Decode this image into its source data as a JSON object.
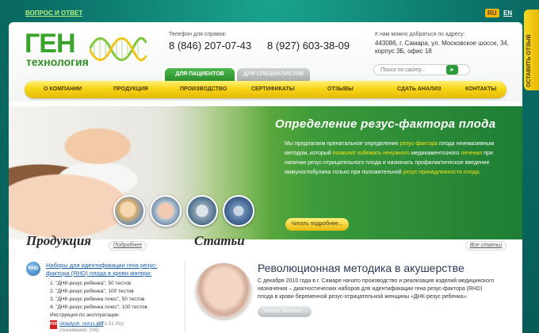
{
  "topbar": {
    "qa_link": "ВОПРОС И ОТВЕТ",
    "lang_ru": "RU",
    "lang_en": "EN"
  },
  "logo": {
    "gen": "ГЕН",
    "tech": "технология"
  },
  "contacts": {
    "phone_caption": "Телефон для справок:",
    "phone1": "8 (846) 207-07-43",
    "phone2": "8 (927) 603-38-09",
    "address_caption": "К нам можно добраться по адресу:",
    "address": "443086, г. Самара, ул. Московское шоссе, 34, корпус 3Б, офис 18"
  },
  "tabs": {
    "patients": "ДЛЯ ПАЦИЕНТОВ",
    "specialists": "ДЛЯ СПЕЦИАЛИСТОВ"
  },
  "search": {
    "placeholder": "Поиск по сайту..."
  },
  "nav": [
    {
      "label": "О КОМПАНИИ"
    },
    {
      "label": "ПРОДУКЦИЯ"
    },
    {
      "label": "ПРОИЗВОДСТВО"
    },
    {
      "label": "СЕРТИФИКАТЫ"
    },
    {
      "label": "ОТЗЫВЫ"
    },
    {
      "label": "СДАТЬ АНАЛИЗ"
    },
    {
      "label": "КОНТАКТЫ"
    }
  ],
  "side_tab": {
    "label": "ОСТАВИТЬ ОТЗЫВ"
  },
  "hero": {
    "title": "Определение резус-фактора плода",
    "text": {
      "p1": "Мы предлагаем  пренатальное определение ",
      "h1": "резус-фактора",
      "p2": " плода неинвазивным методом, который ",
      "h2": "позволит избежать ненужного",
      "p3": " медикаментозного ",
      "h3": "лечения",
      "p4": " при наличии резус-отрицательного плода и назначать профилактическое введение иммуноглобулина только при положительной ",
      "h4": "резус-принадлежности плода",
      "p5": "."
    },
    "button": "Читать подробнее..."
  },
  "products": {
    "title": "Продукция",
    "more": "Подробнее",
    "badge": "RHD",
    "item_title": "Наборы для идентификации гена резус-фактора (RHD) плода в крови матери:",
    "items": [
      "1. \"ДНК-резус ребенка\", 50 тестов",
      "2. \"ДНК-резус ребенка\", 100 тестов",
      "3. \"ДНК-резус ребенка плюс\", 50 тестов",
      "4. \"ДНК-резус ребенка плюс\", 100 тестов"
    ],
    "instr_caption": "Инструкция по эксплуатации",
    "file_name": "vkladysh_rezus.pdf",
    "file_size": "(271.01 Kb)",
    "downloads": "(скачиваний: 104)"
  },
  "articles": {
    "title": "Статьи",
    "all": "Все статьи",
    "article_title": "Революционная методика в акушерстве",
    "article_text": "С декабря 2010 года в г. Самаре начато производство и реализация изделий медицинского назначения – диагностических наборов для идентификации гена резус-фактора (RHD) плода в крови беременной резус-отрицательной женщины «ДНК-резус ребенка».",
    "button": "Узнать больше..."
  }
}
